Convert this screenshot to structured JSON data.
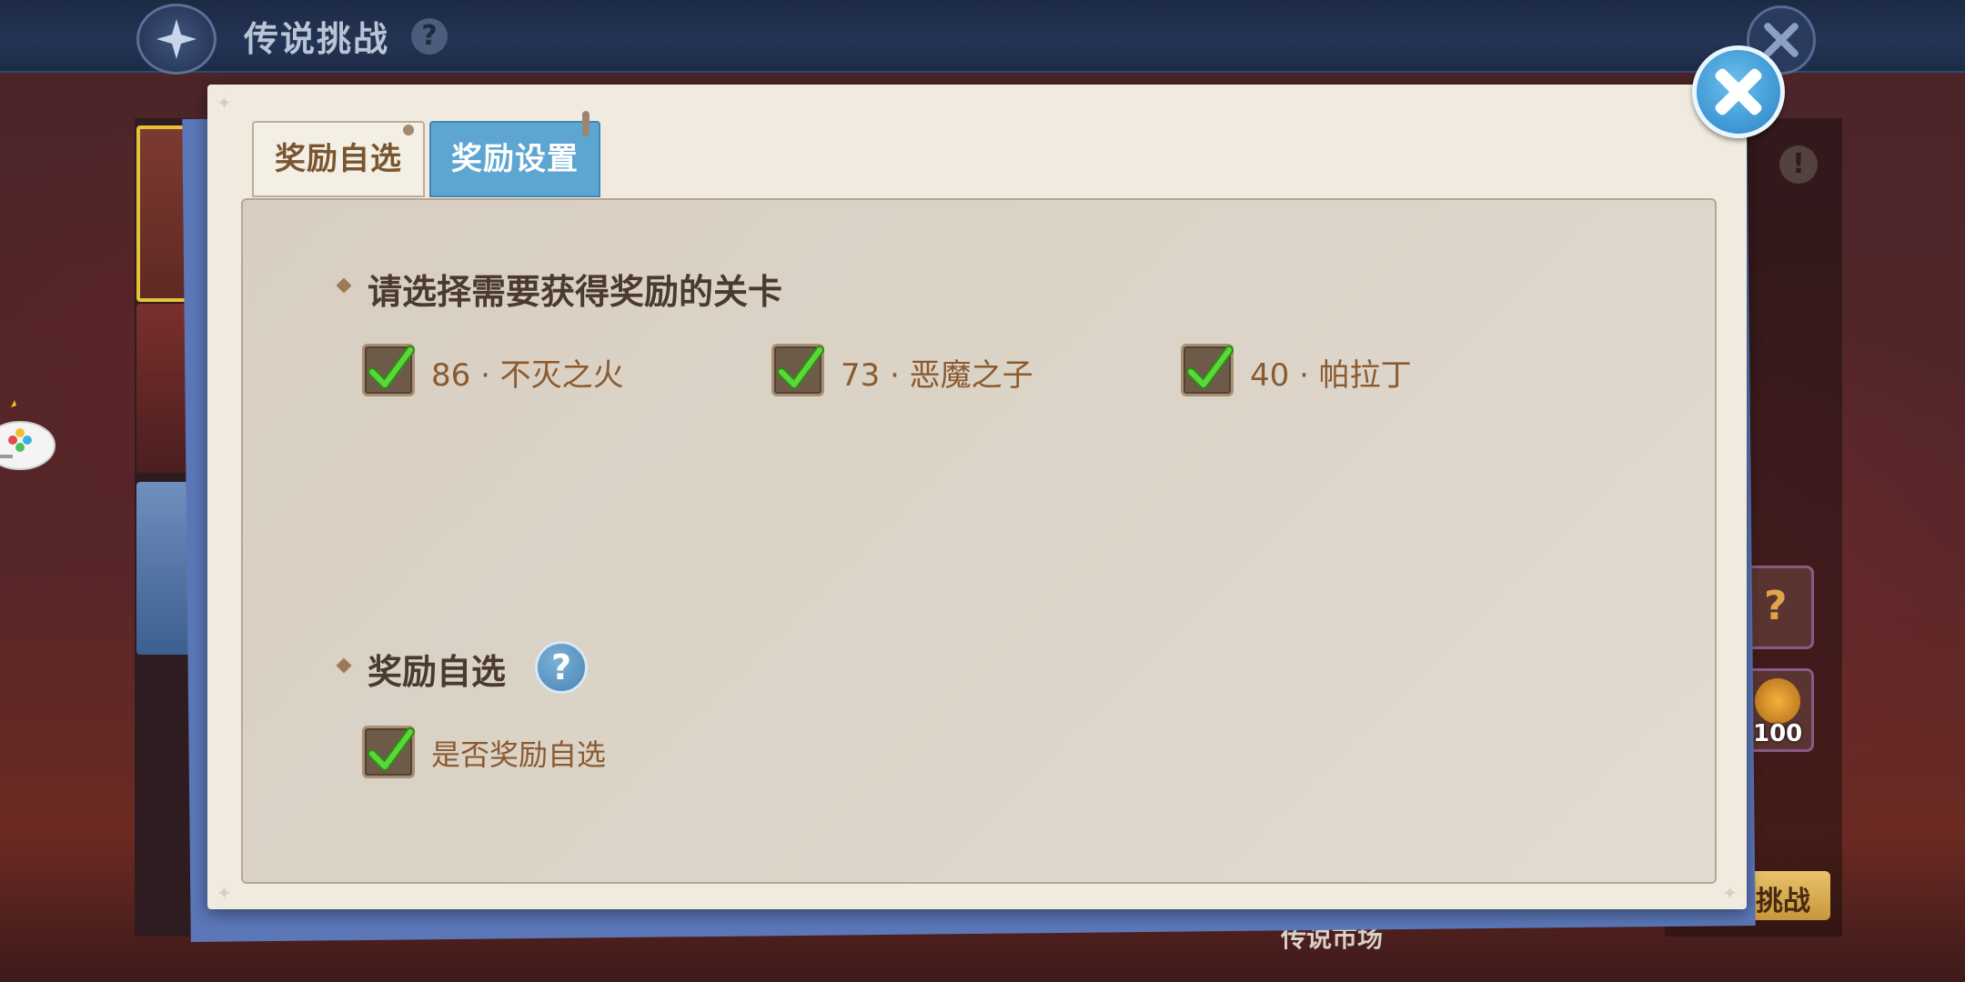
{
  "topbar": {
    "title": "传说挑战",
    "help": "?"
  },
  "background": {
    "coin_count": "100",
    "challenge_label": "挑战",
    "market_label": "传说市场",
    "alert": "!"
  },
  "dialog": {
    "tabs": [
      {
        "label": "奖励自选",
        "active": false
      },
      {
        "label": "奖励设置",
        "active": true
      }
    ],
    "section_levels": {
      "title": "请选择需要获得奖励的关卡",
      "options": [
        {
          "label": "86 · 不灭之火",
          "checked": true
        },
        {
          "label": "73 · 恶魔之子",
          "checked": true
        },
        {
          "label": "40 · 帕拉丁",
          "checked": true
        }
      ]
    },
    "section_reward": {
      "title": "奖励自选",
      "help": "?",
      "option": {
        "label": "是否奖励自选",
        "checked": true
      }
    }
  },
  "colors": {
    "accent_blue": "#5ea6d2",
    "check_green": "#4cc52e",
    "title_brown": "#4b3a2e"
  }
}
